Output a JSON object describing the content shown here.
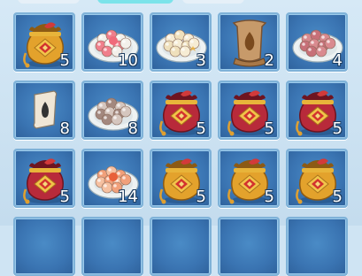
{
  "inventory": {
    "slots": [
      {
        "item": "lucky-bag-gold",
        "count": "5"
      },
      {
        "item": "plate-tangyuan-pink",
        "count": "10"
      },
      {
        "item": "plate-tangyuan-cream",
        "count": "3"
      },
      {
        "item": "scroll-large",
        "count": "2"
      },
      {
        "item": "plate-tangyuan-red",
        "count": "4"
      },
      {
        "item": "scroll-small",
        "count": "8"
      },
      {
        "item": "plate-tangyuan-gray",
        "count": "8"
      },
      {
        "item": "lucky-bag-red",
        "count": "5"
      },
      {
        "item": "lucky-bag-red",
        "count": "5"
      },
      {
        "item": "lucky-bag-red",
        "count": "5"
      },
      {
        "item": "lucky-bag-red",
        "count": "5"
      },
      {
        "item": "plate-tangyuan-orange",
        "count": "14"
      },
      {
        "item": "lucky-bag-gold",
        "count": "5"
      },
      {
        "item": "lucky-bag-gold",
        "count": "5"
      },
      {
        "item": "lucky-bag-gold",
        "count": "5"
      }
    ]
  },
  "colors": {
    "background": "#cfe4f3",
    "slot_fill": "#3a74b2",
    "slot_border": "#7fb2d8",
    "count_text": "#ffffff"
  }
}
